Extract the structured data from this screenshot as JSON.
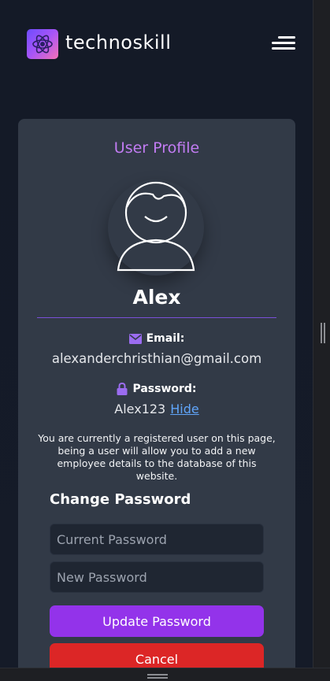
{
  "header": {
    "brand": "technoskill",
    "logo_icon": "atom-icon",
    "menu_icon": "hamburger-icon"
  },
  "profile": {
    "title": "User Profile",
    "name": "Alex",
    "email_label": "Email:",
    "email_value": "alexanderchristhian@gmail.com",
    "password_label": "Password:",
    "password_value": "Alex123",
    "hide_label": "Hide",
    "info_text": "You are currently a registered user on this page, being a user will allow you to add a new employee details to the database of this website."
  },
  "change_password": {
    "title": "Change Password",
    "current_placeholder": "Current Password",
    "new_placeholder": "New Password",
    "update_label": "Update Password",
    "cancel_label": "Cancel"
  },
  "colors": {
    "accent": "#9333ea",
    "title": "#c27cf3",
    "danger": "#dc2626",
    "link": "#60a5fa"
  }
}
